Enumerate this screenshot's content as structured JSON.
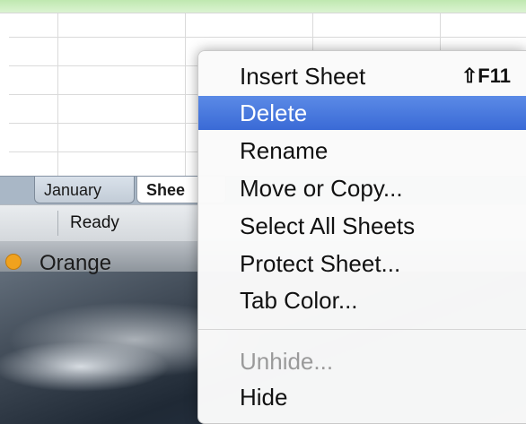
{
  "sheet_tabs": {
    "tab1_label": "January",
    "tab2_label": "Shee"
  },
  "status": {
    "text": "Ready"
  },
  "desktop_item": {
    "label": "Orange",
    "color": "#f0a21e"
  },
  "context_menu": {
    "items": [
      {
        "label": "Insert Sheet",
        "shortcut": "⇧F11",
        "state": "normal"
      },
      {
        "label": "Delete",
        "state": "highlighted"
      },
      {
        "label": "Rename",
        "state": "normal"
      },
      {
        "label": "Move or Copy...",
        "state": "normal"
      },
      {
        "label": "Select All Sheets",
        "state": "normal"
      },
      {
        "label": "Protect Sheet...",
        "state": "normal"
      },
      {
        "label": "Tab Color...",
        "state": "normal"
      },
      {
        "label": "Unhide...",
        "state": "disabled"
      },
      {
        "label": "Hide",
        "state": "normal"
      }
    ],
    "highlight_color": "#3a6ad6"
  }
}
